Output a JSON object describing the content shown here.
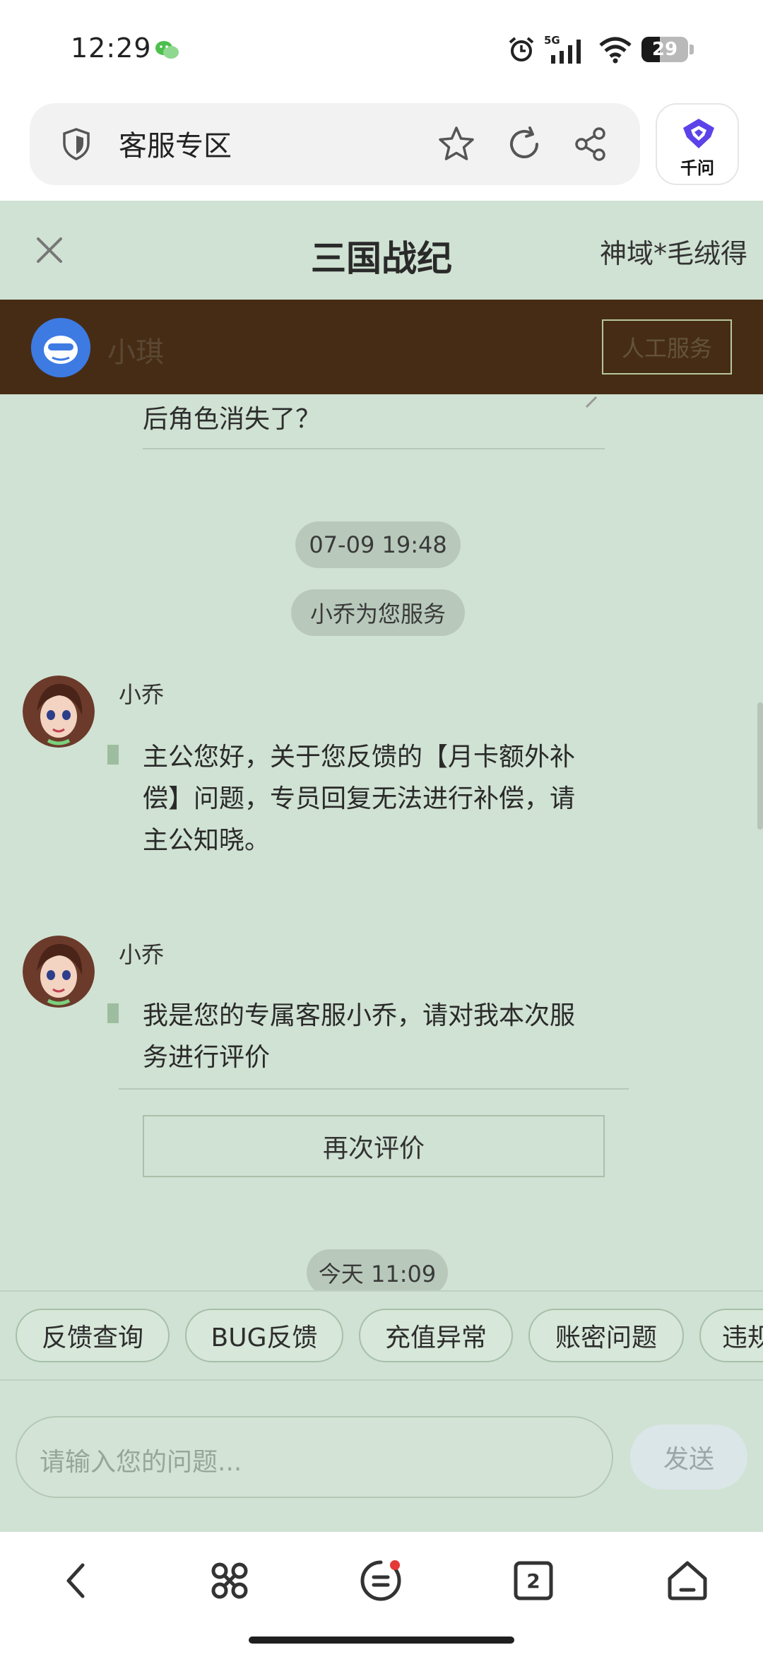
{
  "status": {
    "time": "12:29",
    "network": "5G",
    "battery": "29"
  },
  "browser": {
    "url_title": "客服专区",
    "assistant_label": "千问"
  },
  "app": {
    "title": "三国战纪",
    "server": "神域*毛绒得"
  },
  "banner": {
    "bot_name": "小琪",
    "human_button": "人工服务"
  },
  "chat": {
    "prev_question_tail": "后角色消失了？",
    "time1": "07-09 19:48",
    "service_notice": "小乔为您服务",
    "messages": [
      {
        "sender": "小乔",
        "text": "主公您好，关于您反馈的【月卡额外补偿】问题，专员回复无法进行补偿，请主公知晓。"
      },
      {
        "sender": "小乔",
        "text": "我是您的专属客服小乔，请对我本次服务进行评价"
      }
    ],
    "rate_again": "再次评价",
    "time2": "今天 11:09"
  },
  "quick_chips": [
    "反馈查询",
    "BUG反馈",
    "充值异常",
    "账密问题",
    "违规"
  ],
  "input": {
    "placeholder": "请输入您的问题...",
    "send_label": "发送"
  },
  "nav": {
    "tab_count": "2"
  }
}
